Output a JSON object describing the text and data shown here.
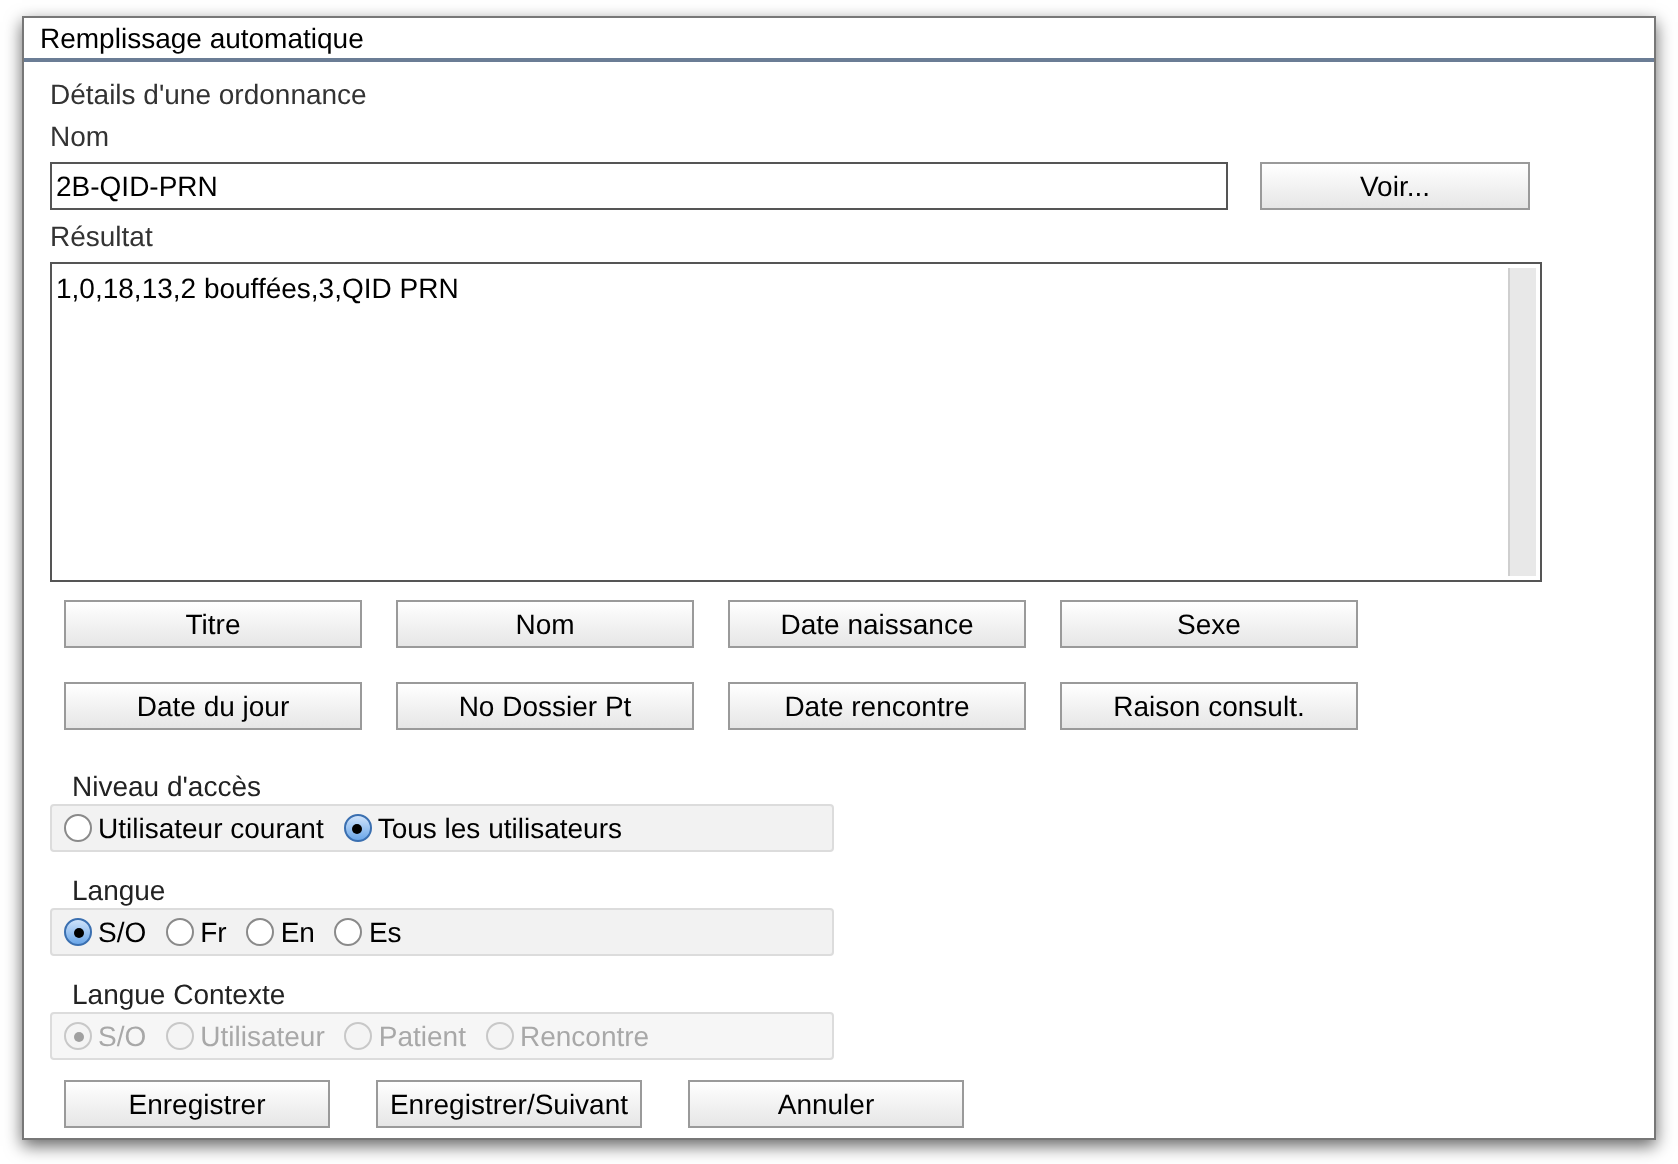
{
  "window": {
    "title": "Remplissage automatique"
  },
  "section_title": "Détails d'une ordonnance",
  "name_field": {
    "label": "Nom",
    "value": "2B-QID-PRN"
  },
  "view_button": "Voir...",
  "result": {
    "label": "Résultat",
    "value": "1,0,18,13,2 bouffées,3,QID PRN"
  },
  "field_buttons": [
    [
      "Titre",
      "Nom",
      "Date naissance",
      "Sexe"
    ],
    [
      "Date du jour",
      "No Dossier Pt",
      "Date rencontre",
      "Raison consult."
    ]
  ],
  "radio_groups": [
    {
      "label": "Niveau d'accès",
      "disabled": false,
      "options": [
        {
          "label": "Utilisateur courant",
          "selected": false
        },
        {
          "label": "Tous les utilisateurs",
          "selected": true
        }
      ]
    },
    {
      "label": "Langue",
      "disabled": false,
      "options": [
        {
          "label": "S/O",
          "selected": true
        },
        {
          "label": "Fr",
          "selected": false
        },
        {
          "label": "En",
          "selected": false
        },
        {
          "label": "Es",
          "selected": false
        }
      ]
    },
    {
      "label": "Langue Contexte",
      "disabled": true,
      "options": [
        {
          "label": "S/O",
          "selected": true
        },
        {
          "label": "Utilisateur",
          "selected": false
        },
        {
          "label": "Patient",
          "selected": false
        },
        {
          "label": "Rencontre",
          "selected": false
        }
      ]
    }
  ],
  "footer_buttons": [
    "Enregistrer",
    "Enregistrer/Suivant",
    "Annuler"
  ]
}
